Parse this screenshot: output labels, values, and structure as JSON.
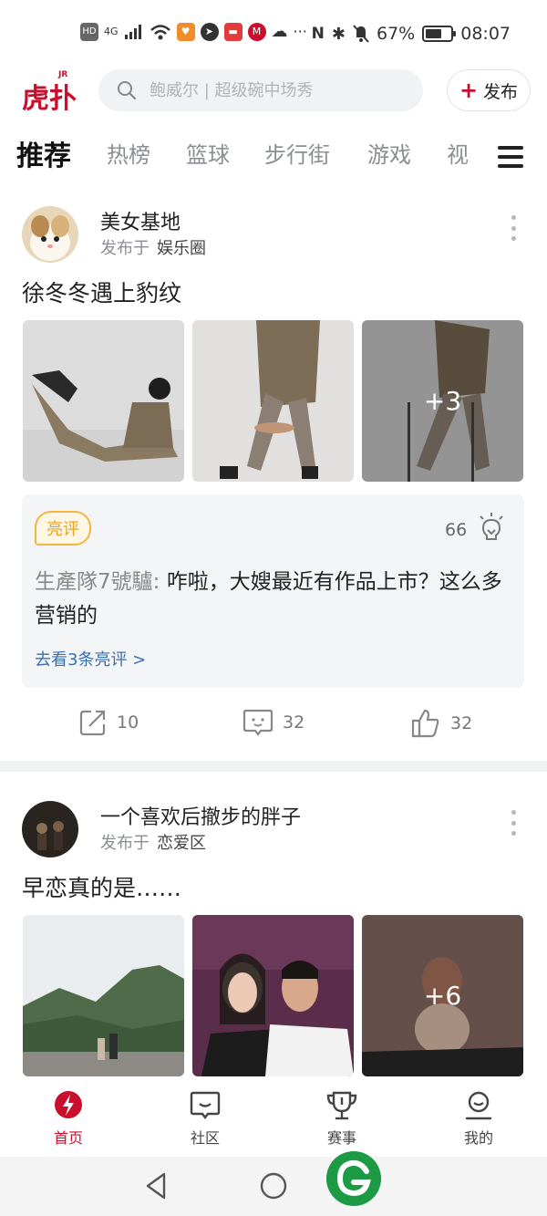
{
  "status_bar": {
    "hd": "HD",
    "network": "4G",
    "battery_percent": "67%",
    "battery_level": 0.67,
    "time": "08:07",
    "more": "···"
  },
  "header": {
    "logo_text": "虎扑",
    "logo_sup": "JR",
    "search_placeholder": "鲍威尔 | 超级碗中场秀",
    "publish_label": "发布"
  },
  "tabs": [
    "推荐",
    "热榜",
    "篮球",
    "步行街",
    "游戏",
    "视"
  ],
  "posts": [
    {
      "author": "美女基地",
      "published_prefix": "发布于",
      "circle": "娱乐圈",
      "title": "徐冬冬遇上豹纹",
      "more_images": "+3",
      "hot_comment": {
        "badge": "亮评",
        "light_count": "66",
        "user": "生產隊7號驢:",
        "text": "咋啦，大嫂最近有作品上市？这么多营销的",
        "link": "去看3条亮评 >"
      },
      "actions": {
        "share": "10",
        "comment": "32",
        "like": "32"
      }
    },
    {
      "author": "一个喜欢后撤步的胖子",
      "published_prefix": "发布于",
      "circle": "恋爱区",
      "title": "早恋真的是……",
      "more_images": "+6"
    }
  ],
  "bottom_nav": [
    {
      "label": "首页",
      "icon": "home-lightning-icon",
      "active": true
    },
    {
      "label": "社区",
      "icon": "community-chat-icon",
      "active": false
    },
    {
      "label": "赛事",
      "icon": "trophy-icon",
      "active": false
    },
    {
      "label": "我的",
      "icon": "user-icon",
      "active": false
    }
  ],
  "colors": {
    "brand": "#c8102e",
    "badge": "#f2b544",
    "link": "#3a6fb5"
  }
}
